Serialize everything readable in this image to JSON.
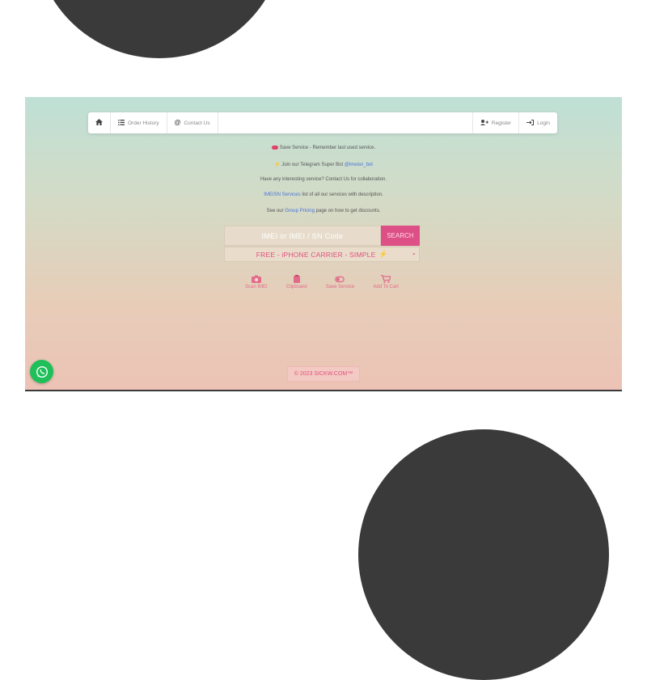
{
  "navbar": {
    "home_icon": "home-icon",
    "order_history": "Order History",
    "contact_us": "Contact Us",
    "register": "Register",
    "login": "Login"
  },
  "info": {
    "line1": "Save Service - Remember last used service.",
    "line2_prefix": "Join our Telegram Super Bot",
    "line2_link": "@imeisn_bot",
    "line3": "Have any interesting service? Contact Us for collaboration.",
    "line4_link": "IMEISN Services",
    "line4_suffix": "list of all our services with description.",
    "line5_prefix": "See our",
    "line5_link": "Group Pricing",
    "line5_suffix": "page on how to get discounts."
  },
  "search": {
    "placeholder": "IMEI or IMEI / SN Code",
    "button": "SEARCH"
  },
  "service_select": {
    "selected": "FREE - iPHONE CARRIER - SIMPLE"
  },
  "actions": [
    {
      "label": "Scan IMEI",
      "icon": "camera-icon"
    },
    {
      "label": "Clipboard",
      "icon": "clipboard-icon"
    },
    {
      "label": "Save Service",
      "icon": "toggle-icon"
    },
    {
      "label": "Add To Cart",
      "icon": "cart-icon"
    }
  ],
  "footer": {
    "copyright": "© 2023 SICKW.COM™"
  },
  "colors": {
    "accent_pink": "#dd4f86",
    "link_blue": "#4a72d8",
    "whatsapp_green": "#1fbf5a",
    "blob_dark": "#3a3a3a"
  }
}
